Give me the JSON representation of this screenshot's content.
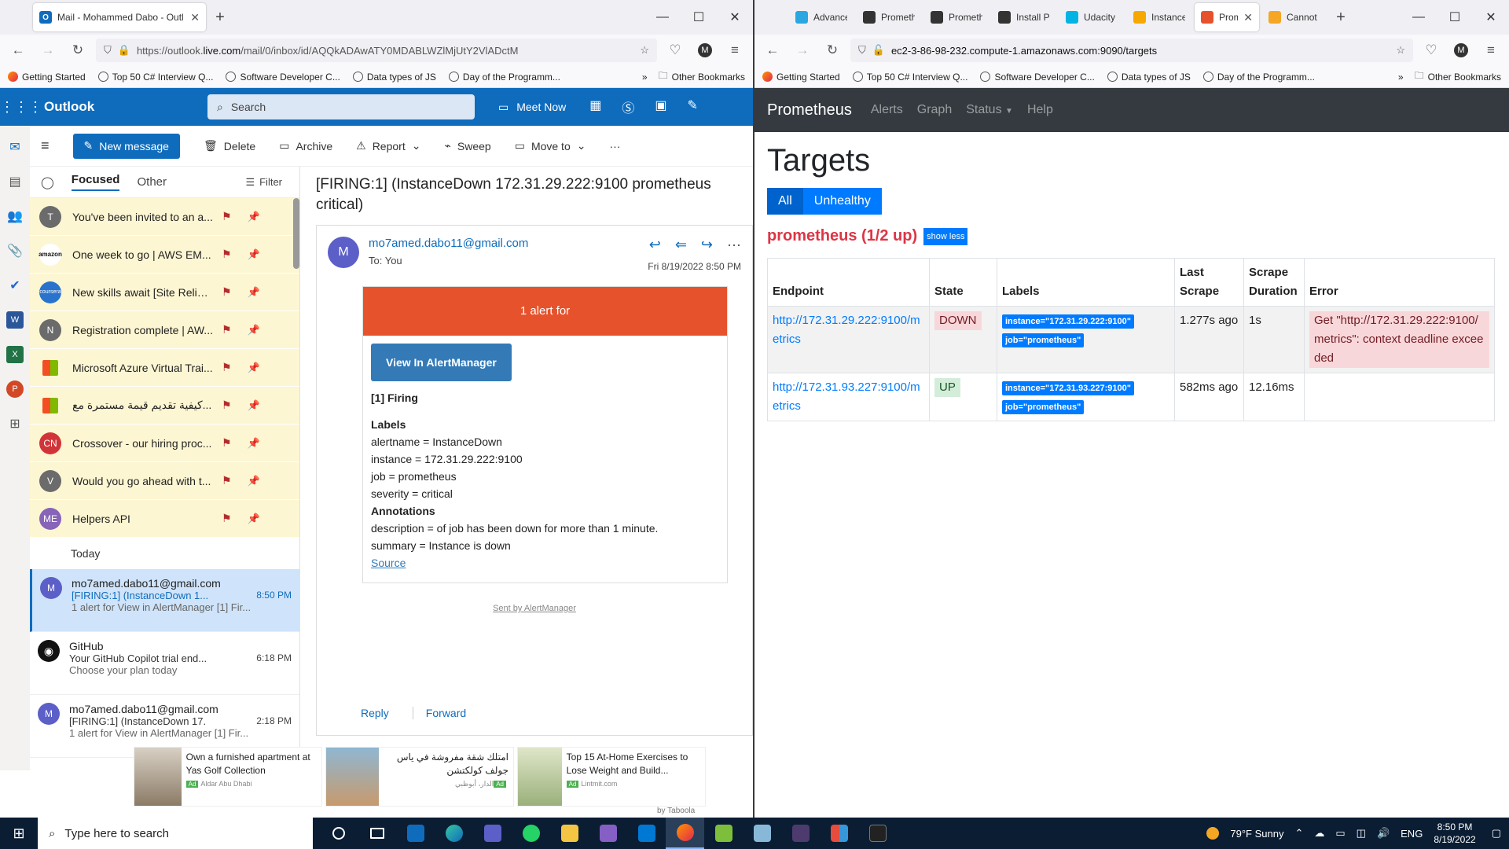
{
  "left_browser": {
    "tabs": [
      {
        "title": "Mail - Mohammed Dabo - Outl",
        "active": true
      }
    ],
    "url_prefix": "https://outlook.",
    "url_host": "live.com",
    "url_rest": "/mail/0/inbox/id/AQQkADAwATY0MDABLWZlMjUtY2VlADctM",
    "bookmarks": [
      "Getting Started",
      "Top 50 C# Interview Q...",
      "Software Developer C...",
      "Data types of JS",
      "Day of the Programm..."
    ],
    "other_bookmarks": "Other Bookmarks",
    "profile_initial": "M"
  },
  "outlook": {
    "brand": "Outlook",
    "search_placeholder": "Search",
    "meet_now": "Meet Now",
    "commands": {
      "new_message": "New message",
      "delete": "Delete",
      "archive": "Archive",
      "report": "Report",
      "sweep": "Sweep",
      "move_to": "Move to"
    },
    "pivots": {
      "focused": "Focused",
      "other": "Other",
      "filter": "Filter"
    },
    "pinned": [
      {
        "initials": "T",
        "color": "#6b6b6b",
        "subject": "You've been invited to an a..."
      },
      {
        "initials": "amazon",
        "color": "#ffffff",
        "subject": "One week to go | AWS EM..."
      },
      {
        "initials": "coursera",
        "color": "#2a73cc",
        "subject": "New skills await [Site Reliab..."
      },
      {
        "initials": "N",
        "color": "#6b6b6b",
        "subject": "Registration complete | AW..."
      },
      {
        "initials": "",
        "color": "#ffffff",
        "subject": "Microsoft Azure Virtual Trai..."
      },
      {
        "initials": "",
        "color": "#ffffff",
        "subject": "كيفية تقديم قيمة مستمرة مع..."
      },
      {
        "initials": "CN",
        "color": "#d13438",
        "subject": "Crossover - our hiring proc..."
      },
      {
        "initials": "V",
        "color": "#6b6b6b",
        "subject": "Would you go ahead with t..."
      },
      {
        "initials": "ME",
        "color": "#8764b8",
        "subject": "Helpers API"
      }
    ],
    "today_label": "Today",
    "messages": [
      {
        "from": "mo7amed.dabo11@gmail.com",
        "subject": "[FIRING:1] (InstanceDown 1...",
        "time": "8:50 PM",
        "preview": "1 alert for View in AlertManager [1] Fir...",
        "avatar": "M",
        "selected": true
      },
      {
        "from": "GitHub",
        "subject": "Your GitHub Copilot trial end...",
        "time": "6:18 PM",
        "preview": "Choose your plan today",
        "avatar": "",
        "selected": false
      },
      {
        "from": "mo7amed.dabo11@gmail.com",
        "subject": "[FIRING:1] (InstanceDown 17...",
        "time": "2:18 PM",
        "preview": "1 alert for View in AlertManager [1] Fir...",
        "avatar": "M",
        "selected": false
      }
    ],
    "reading": {
      "subject": "[FIRING:1] (InstanceDown 172.31.29.222:9100 prometheus critical)",
      "from": "mo7amed.dabo11@gmail.com",
      "to": "To:  You",
      "date": "Fri 8/19/2022 8:50 PM",
      "avatar": "M",
      "banner": "1 alert for",
      "button": "View In AlertManager",
      "firing": "[1] Firing",
      "labels_title": "Labels",
      "labels": [
        "alertname = InstanceDown",
        "instance = 172.31.29.222:9100",
        "job = prometheus",
        "severity = critical"
      ],
      "annotations_title": "Annotations",
      "annotations": [
        "description = of job has been down for more than 1 minute.",
        "summary = Instance is down"
      ],
      "source": "Source",
      "sent_by": "Sent by AlertManager",
      "reply": "Reply",
      "forward": "Forward"
    },
    "ads": [
      {
        "text": "Own a furnished apartment at Yas Golf Collection",
        "source": "Aldar Abu Dhabi"
      },
      {
        "text": "امتلك شقة مفروشة في ياس جولف كولكتشن",
        "source": "الدار، أبوظبي"
      },
      {
        "text": "Top 15 At-Home Exercises to Lose Weight and Build...",
        "source": "Lintmit.com"
      }
    ],
    "ad_badge": "Ad",
    "taboola": "by Taboola"
  },
  "right_browser": {
    "tabs": [
      {
        "title": "Advance",
        "active": false
      },
      {
        "title": "Prometh",
        "active": false
      },
      {
        "title": "Prometh",
        "active": false
      },
      {
        "title": "Install Pr",
        "active": false
      },
      {
        "title": "Udacity",
        "active": false
      },
      {
        "title": "Instance",
        "active": false
      },
      {
        "title": "Prom",
        "active": true
      },
      {
        "title": "Cannot",
        "active": false
      }
    ],
    "url": "ec2-3-86-98-232.compute-1.amazonaws.com:9090/targets",
    "bookmarks": [
      "Getting Started",
      "Top 50 C# Interview Q...",
      "Software Developer C...",
      "Data types of JS",
      "Day of the Programm..."
    ],
    "other_bookmarks": "Other Bookmarks",
    "profile_initial": "M"
  },
  "prometheus": {
    "brand": "Prometheus",
    "nav": [
      "Alerts",
      "Graph",
      "Status",
      "Help"
    ],
    "title": "Targets",
    "filter_all": "All",
    "filter_unhealthy": "Unhealthy",
    "pool": "prometheus (1/2 up)",
    "show_less": "show less",
    "columns": [
      "Endpoint",
      "State",
      "Labels",
      "Last Scrape",
      "Scrape Duration",
      "Error"
    ],
    "rows": [
      {
        "endpoint": "http://172.31.29.222:9100/metrics",
        "state": "DOWN",
        "labels": [
          "instance=\"172.31.29.222:9100\"",
          "job=\"prometheus\""
        ],
        "last_scrape": "1.277s ago",
        "duration": "1s",
        "error": "Get \"http://172.31.29.222:9100/metrics\": context deadline exceeded"
      },
      {
        "endpoint": "http://172.31.93.227:9100/metrics",
        "state": "UP",
        "labels": [
          "instance=\"172.31.93.227:9100\"",
          "job=\"prometheus\""
        ],
        "last_scrape": "582ms ago",
        "duration": "12.16ms",
        "error": ""
      }
    ]
  },
  "taskbar": {
    "search_placeholder": "Type here to search",
    "weather": "79°F  Sunny",
    "lang": "ENG",
    "time": "8:50 PM",
    "date": "8/19/2022"
  }
}
